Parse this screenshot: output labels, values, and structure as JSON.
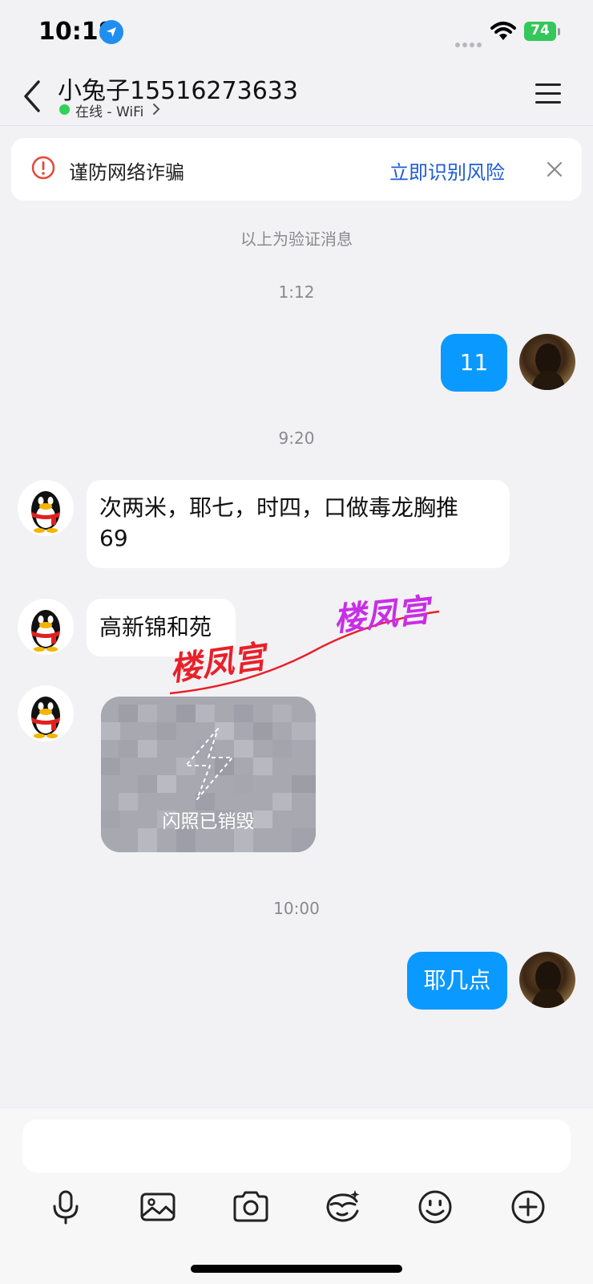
{
  "status_bar": {
    "time": "10:18",
    "battery": "74",
    "location_icon": "location-arrow-icon",
    "wifi_icon": "wifi-icon"
  },
  "header": {
    "title": "小兔子15516273633",
    "status": "在线 - WiFi",
    "status_color": "#30d158"
  },
  "banner": {
    "text": "谨防网络诈骗",
    "link": "立即识别风险",
    "link_color": "#1e5bd6"
  },
  "system_note": "以上为验证消息",
  "conversation": [
    {
      "type": "timestamp",
      "text": "1:12"
    },
    {
      "type": "message",
      "from": "self",
      "text": "11"
    },
    {
      "type": "timestamp",
      "text": "9:20"
    },
    {
      "type": "message",
      "from": "peer",
      "text": "次两米，耶七，时四，口做毒龙胸推69"
    },
    {
      "type": "message",
      "from": "peer",
      "text": "高新锦和苑"
    },
    {
      "type": "flash_image",
      "from": "peer",
      "text": "闪照已销毁"
    },
    {
      "type": "timestamp",
      "text": "10:00"
    },
    {
      "type": "message",
      "from": "self",
      "text": "耶几点"
    }
  ],
  "messages": {
    "ts1": "1:12",
    "out1": "11",
    "ts2": "9:20",
    "in1_line1": "次两米，耶七，时四，口做毒龙胸推",
    "in1_line2": "69",
    "in2": "高新锦和苑",
    "flash": "闪照已销毁",
    "ts3": "10:00",
    "out2": "耶几点"
  },
  "watermark": {
    "text_1": "楼凤宫",
    "text_2": "楼凤宫",
    "color_1": "#e8202a",
    "color_2": "#c82ee6"
  },
  "composer": {
    "input_value": "",
    "tools": [
      "microphone-icon",
      "image-icon",
      "camera-icon",
      "sticker-icon",
      "emoji-icon",
      "plus-icon"
    ]
  },
  "colors": {
    "outgoing_bubble": "#0a99ff",
    "incoming_bubble": "#ffffff",
    "background": "#f2f2f4"
  }
}
